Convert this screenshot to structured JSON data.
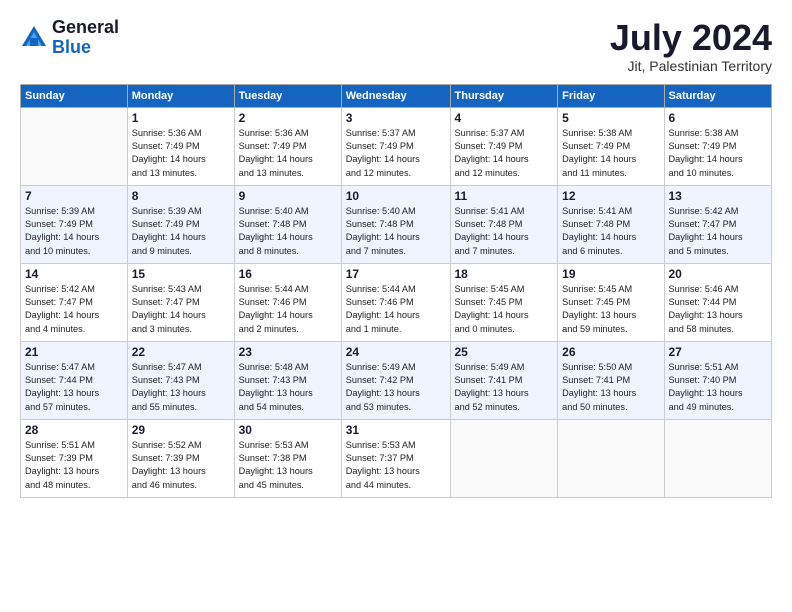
{
  "logo": {
    "general": "General",
    "blue": "Blue"
  },
  "title": "July 2024",
  "subtitle": "Jit, Palestinian Territory",
  "days_header": [
    "Sunday",
    "Monday",
    "Tuesday",
    "Wednesday",
    "Thursday",
    "Friday",
    "Saturday"
  ],
  "weeks": [
    {
      "alt": false,
      "days": [
        {
          "num": "",
          "info": ""
        },
        {
          "num": "1",
          "info": "Sunrise: 5:36 AM\nSunset: 7:49 PM\nDaylight: 14 hours\nand 13 minutes."
        },
        {
          "num": "2",
          "info": "Sunrise: 5:36 AM\nSunset: 7:49 PM\nDaylight: 14 hours\nand 13 minutes."
        },
        {
          "num": "3",
          "info": "Sunrise: 5:37 AM\nSunset: 7:49 PM\nDaylight: 14 hours\nand 12 minutes."
        },
        {
          "num": "4",
          "info": "Sunrise: 5:37 AM\nSunset: 7:49 PM\nDaylight: 14 hours\nand 12 minutes."
        },
        {
          "num": "5",
          "info": "Sunrise: 5:38 AM\nSunset: 7:49 PM\nDaylight: 14 hours\nand 11 minutes."
        },
        {
          "num": "6",
          "info": "Sunrise: 5:38 AM\nSunset: 7:49 PM\nDaylight: 14 hours\nand 10 minutes."
        }
      ]
    },
    {
      "alt": true,
      "days": [
        {
          "num": "7",
          "info": "Sunrise: 5:39 AM\nSunset: 7:49 PM\nDaylight: 14 hours\nand 10 minutes."
        },
        {
          "num": "8",
          "info": "Sunrise: 5:39 AM\nSunset: 7:49 PM\nDaylight: 14 hours\nand 9 minutes."
        },
        {
          "num": "9",
          "info": "Sunrise: 5:40 AM\nSunset: 7:48 PM\nDaylight: 14 hours\nand 8 minutes."
        },
        {
          "num": "10",
          "info": "Sunrise: 5:40 AM\nSunset: 7:48 PM\nDaylight: 14 hours\nand 7 minutes."
        },
        {
          "num": "11",
          "info": "Sunrise: 5:41 AM\nSunset: 7:48 PM\nDaylight: 14 hours\nand 7 minutes."
        },
        {
          "num": "12",
          "info": "Sunrise: 5:41 AM\nSunset: 7:48 PM\nDaylight: 14 hours\nand 6 minutes."
        },
        {
          "num": "13",
          "info": "Sunrise: 5:42 AM\nSunset: 7:47 PM\nDaylight: 14 hours\nand 5 minutes."
        }
      ]
    },
    {
      "alt": false,
      "days": [
        {
          "num": "14",
          "info": "Sunrise: 5:42 AM\nSunset: 7:47 PM\nDaylight: 14 hours\nand 4 minutes."
        },
        {
          "num": "15",
          "info": "Sunrise: 5:43 AM\nSunset: 7:47 PM\nDaylight: 14 hours\nand 3 minutes."
        },
        {
          "num": "16",
          "info": "Sunrise: 5:44 AM\nSunset: 7:46 PM\nDaylight: 14 hours\nand 2 minutes."
        },
        {
          "num": "17",
          "info": "Sunrise: 5:44 AM\nSunset: 7:46 PM\nDaylight: 14 hours\nand 1 minute."
        },
        {
          "num": "18",
          "info": "Sunrise: 5:45 AM\nSunset: 7:45 PM\nDaylight: 14 hours\nand 0 minutes."
        },
        {
          "num": "19",
          "info": "Sunrise: 5:45 AM\nSunset: 7:45 PM\nDaylight: 13 hours\nand 59 minutes."
        },
        {
          "num": "20",
          "info": "Sunrise: 5:46 AM\nSunset: 7:44 PM\nDaylight: 13 hours\nand 58 minutes."
        }
      ]
    },
    {
      "alt": true,
      "days": [
        {
          "num": "21",
          "info": "Sunrise: 5:47 AM\nSunset: 7:44 PM\nDaylight: 13 hours\nand 57 minutes."
        },
        {
          "num": "22",
          "info": "Sunrise: 5:47 AM\nSunset: 7:43 PM\nDaylight: 13 hours\nand 55 minutes."
        },
        {
          "num": "23",
          "info": "Sunrise: 5:48 AM\nSunset: 7:43 PM\nDaylight: 13 hours\nand 54 minutes."
        },
        {
          "num": "24",
          "info": "Sunrise: 5:49 AM\nSunset: 7:42 PM\nDaylight: 13 hours\nand 53 minutes."
        },
        {
          "num": "25",
          "info": "Sunrise: 5:49 AM\nSunset: 7:41 PM\nDaylight: 13 hours\nand 52 minutes."
        },
        {
          "num": "26",
          "info": "Sunrise: 5:50 AM\nSunset: 7:41 PM\nDaylight: 13 hours\nand 50 minutes."
        },
        {
          "num": "27",
          "info": "Sunrise: 5:51 AM\nSunset: 7:40 PM\nDaylight: 13 hours\nand 49 minutes."
        }
      ]
    },
    {
      "alt": false,
      "days": [
        {
          "num": "28",
          "info": "Sunrise: 5:51 AM\nSunset: 7:39 PM\nDaylight: 13 hours\nand 48 minutes."
        },
        {
          "num": "29",
          "info": "Sunrise: 5:52 AM\nSunset: 7:39 PM\nDaylight: 13 hours\nand 46 minutes."
        },
        {
          "num": "30",
          "info": "Sunrise: 5:53 AM\nSunset: 7:38 PM\nDaylight: 13 hours\nand 45 minutes."
        },
        {
          "num": "31",
          "info": "Sunrise: 5:53 AM\nSunset: 7:37 PM\nDaylight: 13 hours\nand 44 minutes."
        },
        {
          "num": "",
          "info": ""
        },
        {
          "num": "",
          "info": ""
        },
        {
          "num": "",
          "info": ""
        }
      ]
    }
  ]
}
